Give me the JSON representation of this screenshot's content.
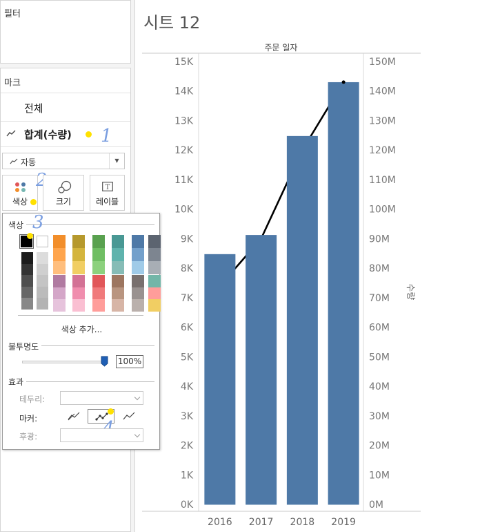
{
  "sidebar": {
    "filters": {
      "title": "필터"
    },
    "marks": {
      "title": "마크",
      "all_label": "전체",
      "measure_label": "합계(수량)",
      "mark_type": "자동",
      "buttons": [
        {
          "label": "색상",
          "icon": "color-dots-icon"
        },
        {
          "label": "크기",
          "icon": "size-circles-icon"
        },
        {
          "label": "레이블",
          "icon": "label-text-icon"
        }
      ]
    },
    "annotations": [
      "1",
      "2",
      "3",
      "4"
    ]
  },
  "color_popup": {
    "color_title": "색상",
    "add_color": "색상 추가...",
    "opacity_title": "불투명도",
    "opacity_value": "100%",
    "opacity_fraction": 1.0,
    "effects_title": "효과",
    "border_label": "테두리:",
    "marker_label": "마커:",
    "halo_label": "후광:",
    "selected_swatch": "#000000",
    "grays": [
      "#1c1c1c",
      "#343434",
      "#4f4f4f",
      "#676767",
      "#888888"
    ],
    "light_grays": [
      "#dcdcdc",
      "#cfcfcf",
      "#c4c4c4",
      "#bbbbbb",
      "#b3b3b3"
    ],
    "palette_top": [
      [
        "#f28e2b",
        "#ffa54d",
        "#ffbe7d"
      ],
      [
        "#b6992d",
        "#d4b53d",
        "#f1ce63"
      ],
      [
        "#59a14f",
        "#6fbe63",
        "#8cd17d"
      ],
      [
        "#499894",
        "#5fb3ad",
        "#86bcb6"
      ],
      [
        "#4e79a7",
        "#73a0cb",
        "#a0cbe8"
      ],
      [
        "#5c6470",
        "#7d8590",
        "#a8aeb5"
      ]
    ],
    "palette_bottom": [
      [
        "#b07aa1",
        "#d4a6c8",
        "#e6c3dc"
      ],
      [
        "#d37295",
        "#f08eae",
        "#fabfd2"
      ],
      [
        "#e15759",
        "#f07a7b",
        "#ff9d9a"
      ],
      [
        "#9d7660",
        "#b99580",
        "#d7b5a6"
      ],
      [
        "#79706e",
        "#9a9290",
        "#bab0ac"
      ],
      [
        "#72b6a8",
        "#ff9d9a",
        "#f1ce63"
      ]
    ]
  },
  "sheet": {
    "title": "시트 12"
  },
  "chart_data": {
    "type": "bar",
    "top_label": "주문 일자",
    "categories": [
      "2016",
      "2017",
      "2018",
      "2019"
    ],
    "bar_color": "#4e79a7",
    "series": [
      {
        "values": [
          8475,
          9124,
          12476,
          14299
        ]
      },
      {
        "values": [
          74,
          90,
          120,
          143
        ]
      }
    ],
    "ylim": [
      0,
      15000
    ],
    "y_ticks": [
      "0K",
      "1K",
      "2K",
      "3K",
      "4K",
      "5K",
      "6K",
      "7K",
      "8K",
      "9K",
      "10K",
      "11K",
      "12K",
      "13K",
      "14K",
      "15K"
    ],
    "y2lim": [
      0,
      150
    ],
    "y2_ticks": [
      "0M",
      "10M",
      "20M",
      "30M",
      "40M",
      "50M",
      "60M",
      "70M",
      "80M",
      "90M",
      "100M",
      "110M",
      "120M",
      "130M",
      "140M",
      "150M"
    ],
    "y2label": "수량"
  }
}
